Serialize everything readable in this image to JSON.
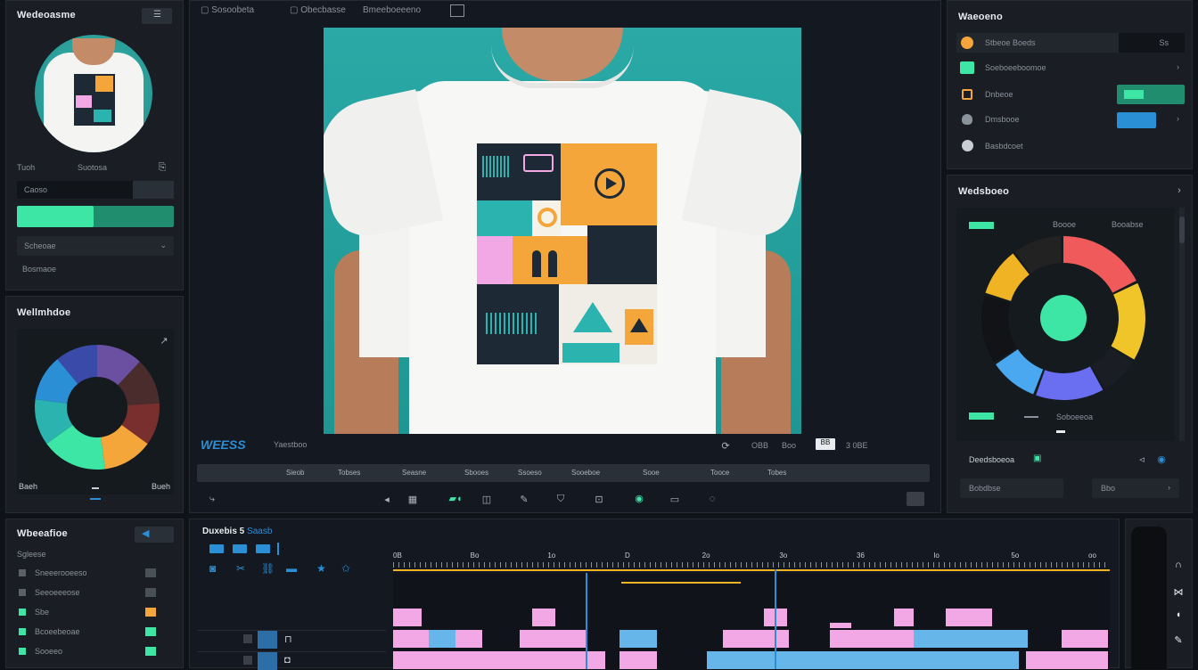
{
  "colors": {
    "accent": "#3ee6a6",
    "accent_blue": "#2b8fd6",
    "orange": "#f4a63b",
    "pink": "#f3a8e6",
    "lightblue": "#66b6ea",
    "yellow": "#f0b323",
    "teal": "#2bb3b0"
  },
  "left_top": {
    "title": "Wedeoasme",
    "row1_left": "Tuoh",
    "row1_mid": "Suotosa",
    "field1": "Caoso",
    "progress_fraction": 0.49,
    "field2": "Scheoae",
    "field3": "Bosmaoe"
  },
  "left_mid": {
    "title": "Wellmhdoe",
    "bottom_left": "Baeh",
    "bottom_right": "Bueh"
  },
  "donut_left": {
    "segments": [
      {
        "value": 12,
        "color": "#6b4fa0"
      },
      {
        "value": 12,
        "color": "#4a2c2c"
      },
      {
        "value": 11,
        "color": "#7a2f2f"
      },
      {
        "value": 13,
        "color": "#f4a63b"
      },
      {
        "value": 17,
        "color": "#3ee6a6"
      },
      {
        "value": 12,
        "color": "#2bb3b0"
      },
      {
        "value": 12,
        "color": "#2b8fd6"
      },
      {
        "value": 11,
        "color": "#3a4aa8"
      }
    ]
  },
  "top_tabs": [
    "Sosoobeta",
    "Obecbasse",
    "Bmeeboeeeno"
  ],
  "preview": {
    "badge": "WEESS",
    "label": "Yaestboo",
    "time1": "OBB",
    "time2": "Boo",
    "tc": "3 0BE",
    "btn": "BB"
  },
  "transport": {
    "markers": [
      "Sieob",
      "Tobses",
      "Seasne",
      "Sbooes",
      "Ssoeso",
      "Sooeboe",
      "Sooe",
      "Tooce",
      "Tobes"
    ]
  },
  "right_top": {
    "title": "Waeoeno",
    "items": [
      {
        "label": "Stbeoe Boeds",
        "value": "Ss",
        "icon": "circle-icon",
        "color": "#f4a63b"
      },
      {
        "label": "Soeboeeboomoe",
        "icon": "square-icon",
        "color": "#3ee6a6"
      },
      {
        "label": "Dnbeoe",
        "icon": "bag-icon",
        "color": "#f4a63b"
      },
      {
        "label": "Dmsbooe",
        "icon": "shield-icon",
        "color": "#8a929c"
      },
      {
        "label": "Basbdcoet",
        "icon": "clock-icon",
        "color": "#c9ced6"
      }
    ]
  },
  "right_mid": {
    "title": "Wedsboeo",
    "legend_left": "Boooe",
    "legend_mid": "Booabse",
    "scale": "Soboeeoa",
    "sub": "Deedsboeoa",
    "btn1": "Bobdbse",
    "btn2": "Bbo"
  },
  "donut_right": {
    "segments": [
      {
        "value": 18,
        "color": "#f05a5a"
      },
      {
        "value": 16,
        "color": "#f0c52a"
      },
      {
        "value": 8,
        "color": "#1a1e24"
      },
      {
        "value": 14,
        "color": "#6a6ef0"
      },
      {
        "value": 10,
        "color": "#4aa8f0"
      },
      {
        "value": 14,
        "color": "#111316"
      },
      {
        "value": 10,
        "color": "#f0b323"
      },
      {
        "value": 10,
        "color": "#222"
      }
    ],
    "center_color": "#3ee6a6"
  },
  "left_bottom": {
    "title": "Wbeeafioe",
    "sub": "Sgleese",
    "items": [
      "Sneeerooeeso",
      "Seeoeeeose",
      "Sbe",
      "Bcoeebeoae",
      "Sooeeo"
    ]
  },
  "timeline": {
    "title": "Duxebis 5",
    "title_accent": "Saasb",
    "ruler": [
      "0B",
      "Bo",
      "1o",
      "D",
      "2o",
      "3o",
      "36",
      "lo",
      "5o",
      "oo"
    ]
  }
}
